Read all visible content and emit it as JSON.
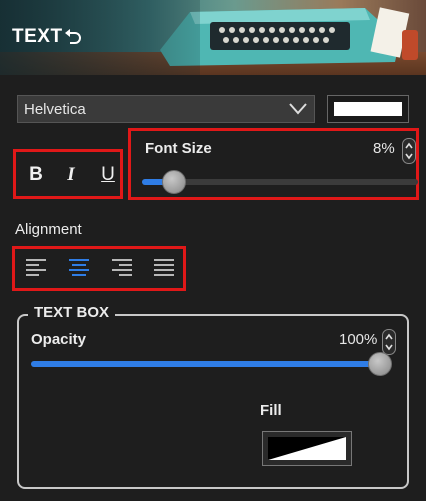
{
  "header": {
    "title": "TEXT",
    "undo_icon": "undo-icon"
  },
  "font": {
    "family": "Helvetica",
    "color": "#ffffff"
  },
  "styles": {
    "bold": "B",
    "italic": "I",
    "underline": "U"
  },
  "font_size": {
    "label": "Font Size",
    "value": "8%",
    "level_percent": 8
  },
  "alignment": {
    "label": "Alignment",
    "options": [
      "align-left",
      "align-center",
      "align-right",
      "align-justify"
    ],
    "selected": "align-center"
  },
  "text_box": {
    "legend": "TEXT BOX",
    "opacity": {
      "label": "Opacity",
      "value": "100%",
      "level_percent": 100
    },
    "fill": {
      "label": "Fill"
    }
  },
  "colors": {
    "accent": "#2f7de6",
    "highlight": "#e01818",
    "panel": "#1e1e1e"
  }
}
